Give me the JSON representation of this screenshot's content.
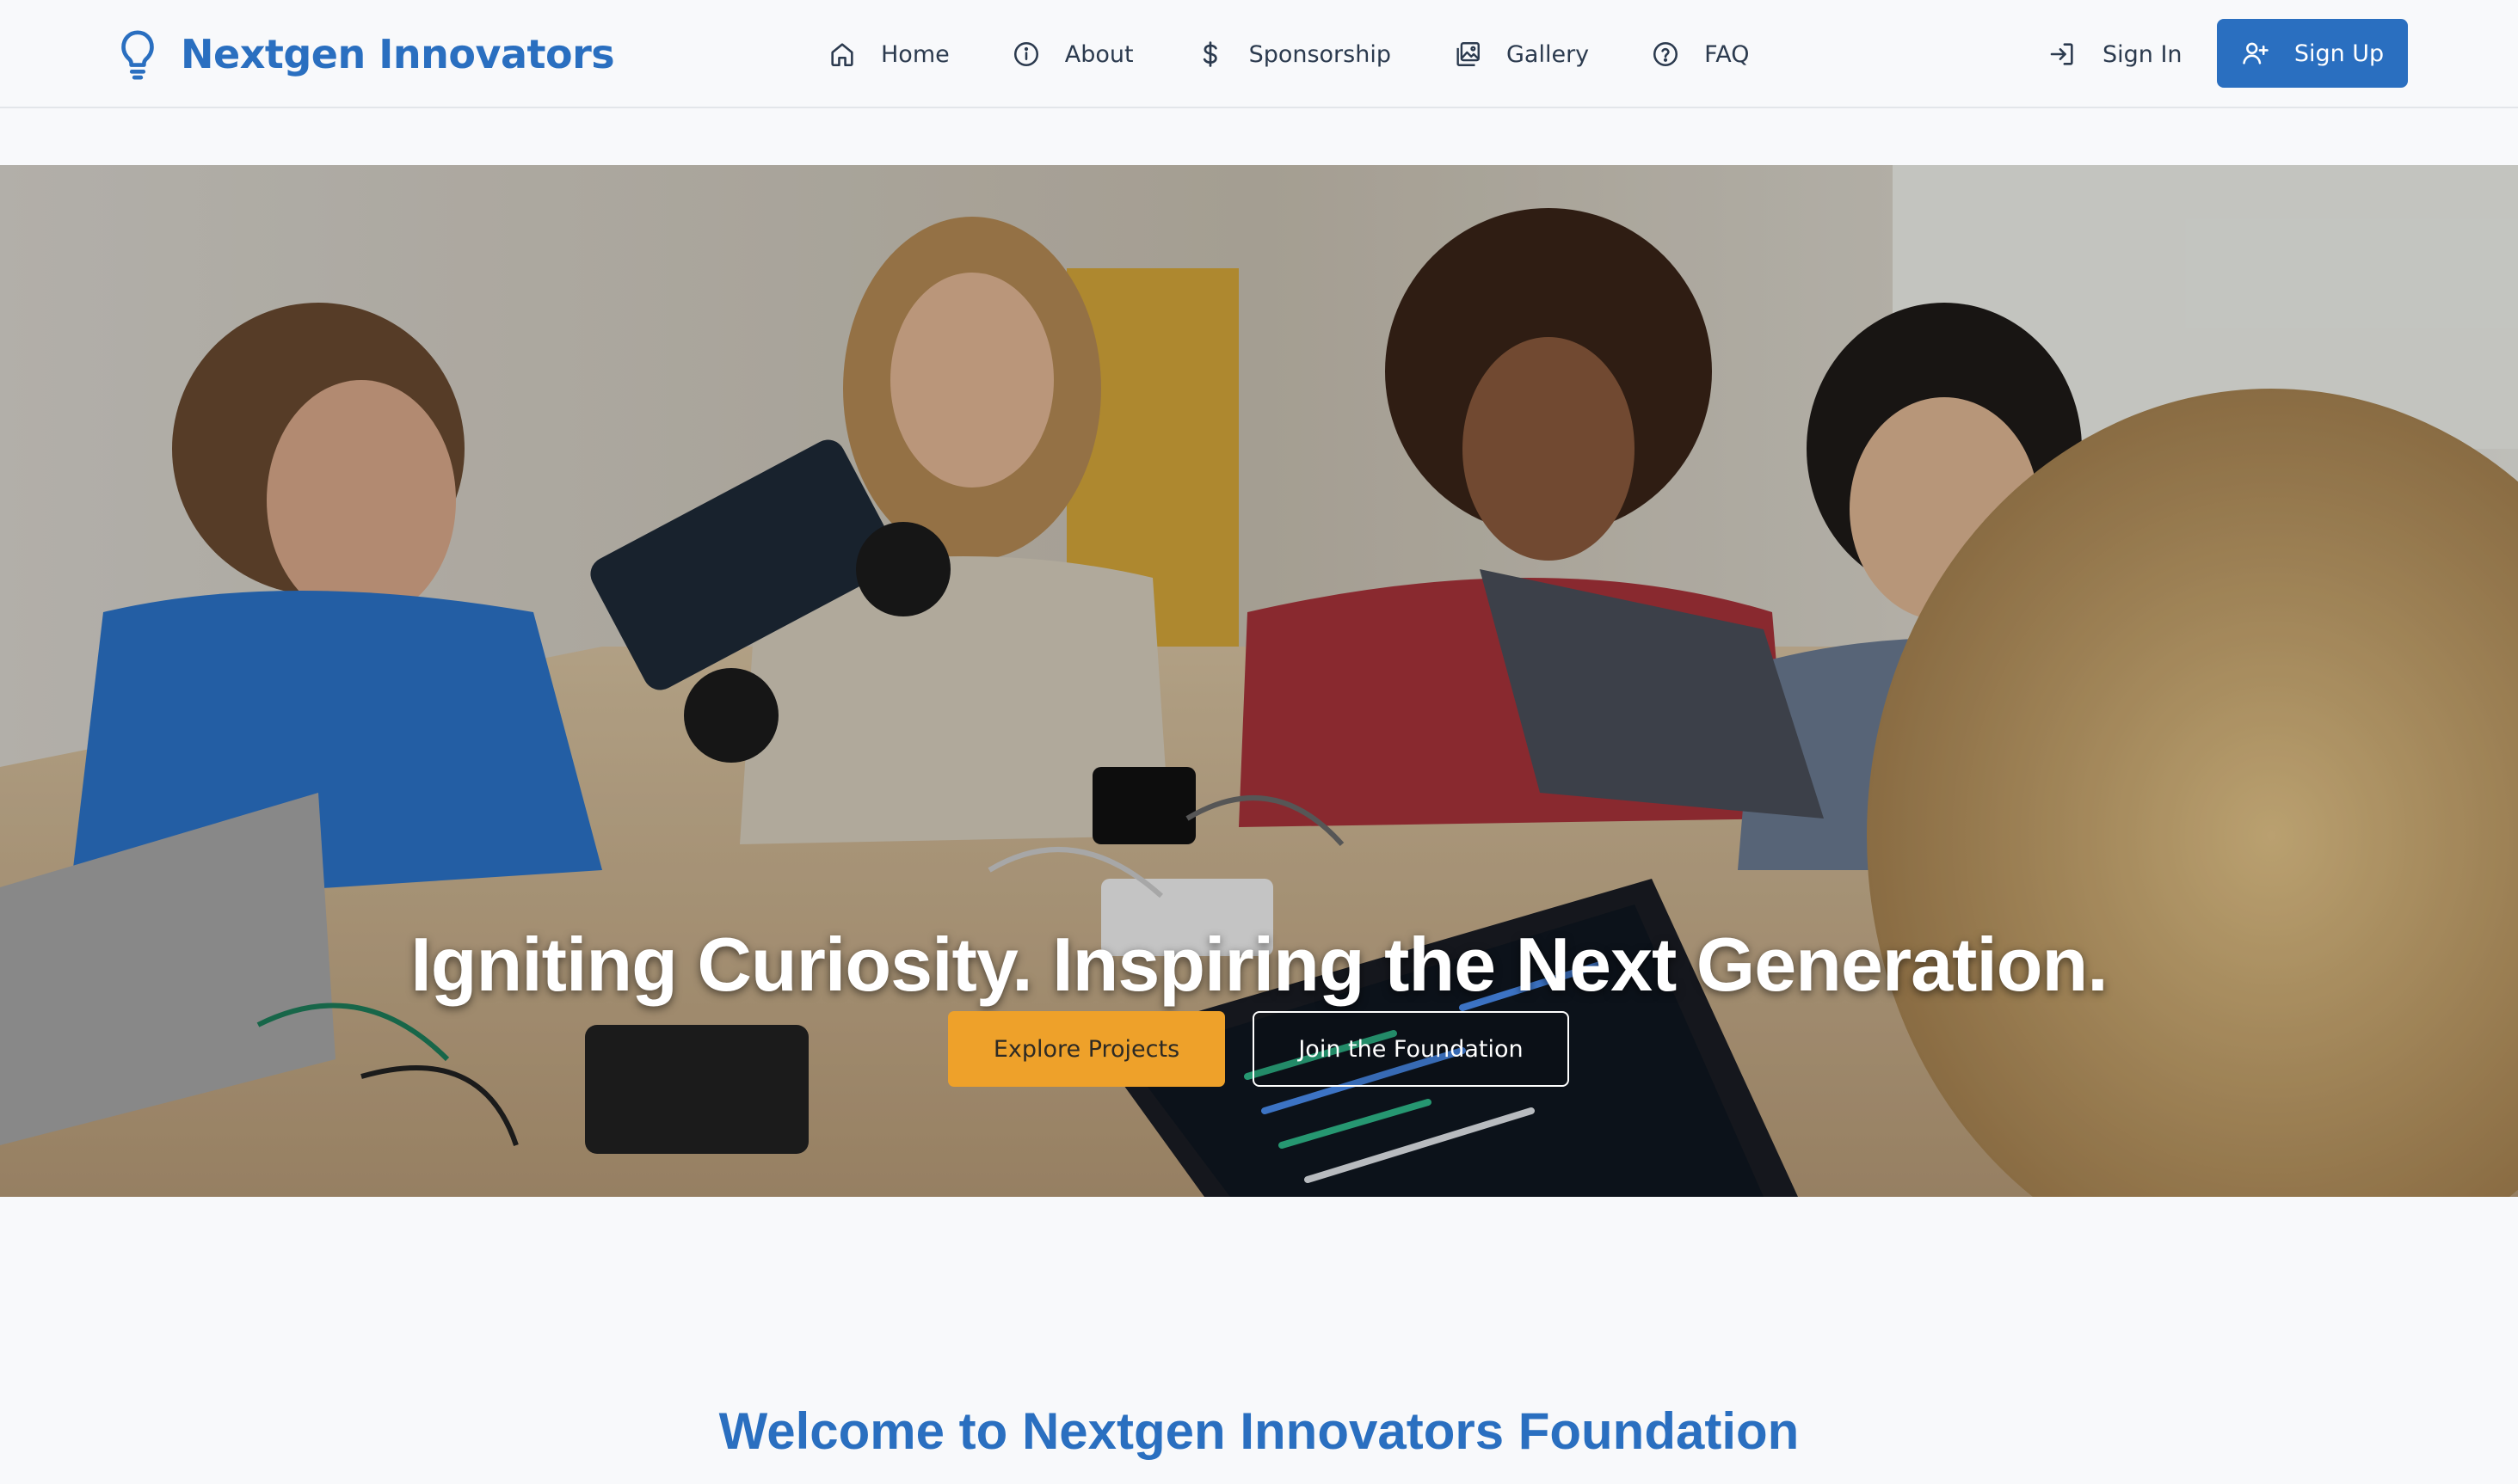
{
  "brand": {
    "name": "Nextgen Innovators",
    "icon": "lightbulb-icon",
    "color": "#2a6fc0"
  },
  "nav": {
    "items": [
      {
        "label": "Home",
        "icon": "home-icon"
      },
      {
        "label": "About",
        "icon": "info-icon"
      },
      {
        "label": "Sponsorship",
        "icon": "dollar-icon"
      },
      {
        "label": "Gallery",
        "icon": "gallery-icon"
      },
      {
        "label": "FAQ",
        "icon": "question-icon"
      }
    ],
    "sign_in": {
      "label": "Sign In",
      "icon": "sign-in-icon"
    },
    "sign_up": {
      "label": "Sign Up",
      "icon": "user-plus-icon"
    }
  },
  "hero": {
    "headline": "Igniting Curiosity. Inspiring the Next Generation.",
    "primary_cta": "Explore Projects",
    "secondary_cta": "Join the Foundation",
    "image": "photo of children building a robot car and coding on laptops at a workshop table"
  },
  "welcome": {
    "title": "Welcome to Nextgen Innovators Foundation"
  },
  "colors": {
    "primary": "#2a6fc0",
    "accent": "#eea12a",
    "background": "#f8f9fb",
    "text": "#2b3a4e"
  }
}
